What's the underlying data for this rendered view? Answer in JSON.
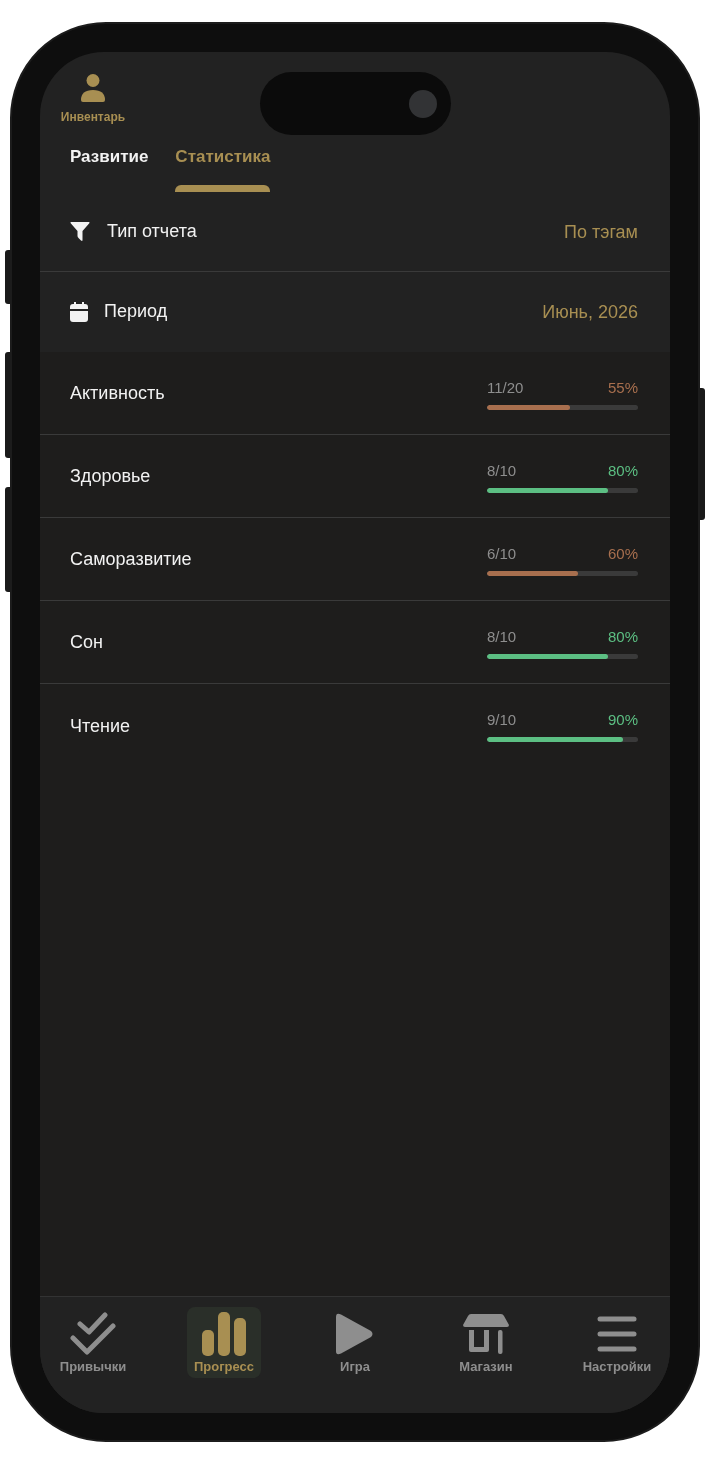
{
  "header": {
    "inventory_label": "Инвентарь"
  },
  "tabs": [
    {
      "label": "Развитие",
      "selected": false
    },
    {
      "label": "Статистика",
      "selected": true
    }
  ],
  "report_settings": [
    {
      "label": "Тип отчета",
      "value": "По тэгам"
    },
    {
      "label": "Период",
      "value": "Июнь, 2026"
    }
  ],
  "stats": [
    {
      "name": "Активность",
      "count": "11/20",
      "percent": "55%",
      "level": 0.55,
      "color": "#a86f4e"
    },
    {
      "name": "Здоровье",
      "count": "8/10",
      "percent": "80%",
      "level": 0.8,
      "color": "#5cbf83"
    },
    {
      "name": "Саморазвитие",
      "count": "6/10",
      "percent": "60%",
      "level": 0.6,
      "color": "#a86f4e"
    },
    {
      "name": "Сон",
      "count": "8/10",
      "percent": "80%",
      "level": 0.8,
      "color": "#5cbf83"
    },
    {
      "name": "Чтение",
      "count": "9/10",
      "percent": "90%",
      "level": 0.9,
      "color": "#5cbf83"
    }
  ],
  "bottom_nav": [
    {
      "label": "Привычки",
      "selected": false
    },
    {
      "label": "Прогресс",
      "selected": true
    },
    {
      "label": "Игра",
      "selected": false
    },
    {
      "label": "Магазин",
      "selected": false
    },
    {
      "label": "Настройки",
      "selected": false
    }
  ]
}
